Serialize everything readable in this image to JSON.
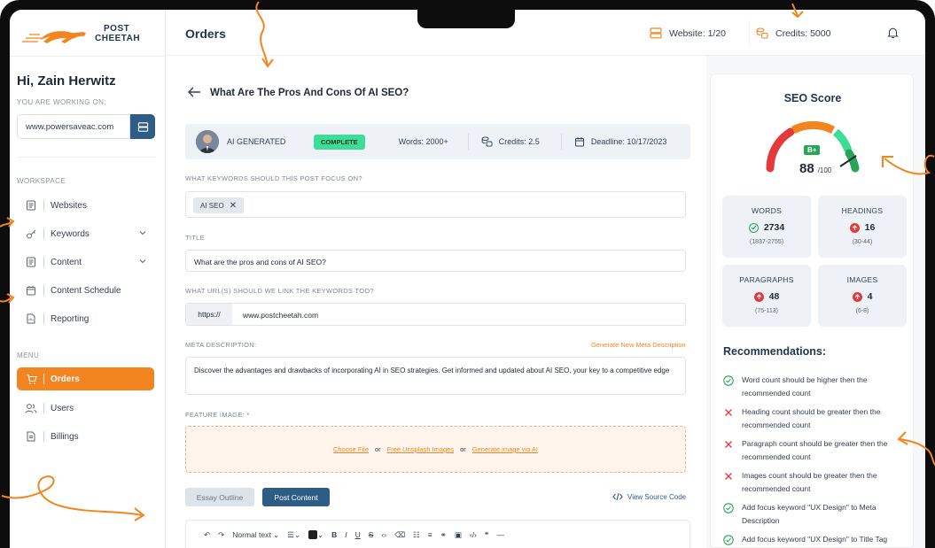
{
  "app": {
    "logo_line1": "POST",
    "logo_line2": "CHEETAH"
  },
  "header": {
    "title": "Orders",
    "website": "Website: 1/20",
    "credits": "Credits: 5000"
  },
  "sidebar": {
    "greeting": "Hi, Zain Herwitz",
    "working_label": "YOU ARE WORKING ON:",
    "site": "www.powersaveac.com",
    "workspace_label": "WORKSPACE",
    "menu_label": "MENU",
    "workspace_items": [
      {
        "label": "Websites",
        "icon": "document-icon"
      },
      {
        "label": "Keywords",
        "icon": "key-icon"
      },
      {
        "label": "Content",
        "icon": "document-icon"
      },
      {
        "label": "Content Schedule",
        "icon": "calendar-icon"
      },
      {
        "label": "Reporting",
        "icon": "report-icon"
      }
    ],
    "menu_items": [
      {
        "label": "Orders",
        "icon": "cart-icon",
        "active": true
      },
      {
        "label": "Users",
        "icon": "users-icon"
      },
      {
        "label": "Billings",
        "icon": "billing-icon"
      }
    ]
  },
  "post": {
    "title": "What Are The Pros And Cons Of AI SEO?",
    "ai_label": "AI GENERATED",
    "status": "COMPLETE",
    "words": "Words: 2000+",
    "credits": "Credits: 2.5",
    "deadline": "Deadline: 10/17/2023",
    "keywords_label": "WHAT KEYWORDS SHOULD THIS POST FOCUS ON?",
    "keyword_chip": "AI SEO",
    "title_label": "TITLE",
    "title_value": "What are the pros and cons of AI SEO?",
    "url_label": "WHAT URL(S) SHOULD WE LINK THE KEYWORDS TOO?",
    "url_prefix": "https://",
    "url_value": "www.postcheetah.com",
    "meta_label": "META DESCRIPTION:",
    "meta_generate": "Generate New Meta Description",
    "meta_value": "Discover the advantages and drawbacks of incorporating AI in SEO strategies. Get informed and updated about AI SEO, your key to a competitive edge",
    "feature_label": "FEATURE IMAGE: *",
    "choose_file": "Choose File",
    "or1": "or",
    "unsplash": "Free Unsplash Images",
    "or2": "or",
    "gen_ai": "Generate image via AI",
    "essay_outline": "Essay Outline",
    "post_content": "Post Content",
    "view_source": "View Source Code",
    "toolbar_style": "Normal text"
  },
  "seo": {
    "title": "SEO Score",
    "grade": "B+",
    "score": "88",
    "score_max": "/100",
    "score_value": 88,
    "stats": [
      {
        "label": "WORDS",
        "value": "2734",
        "range": "(1837-2755)",
        "status": "ok"
      },
      {
        "label": "HEADINGS",
        "value": "16",
        "range": "(30-44)",
        "status": "up"
      },
      {
        "label": "PARAGRAPHS",
        "value": "48",
        "range": "(75-113)",
        "status": "up"
      },
      {
        "label": "IMAGES",
        "value": "4",
        "range": "(6-8)",
        "status": "up"
      }
    ],
    "rec_title": "Recommendations:",
    "recommendations": [
      {
        "text": "Word count should be higher then the recommended count",
        "status": "ok"
      },
      {
        "text": "Heading count should be greater then the recommended count",
        "status": "fail"
      },
      {
        "text": "Paragraph count should be greater then the recommended count",
        "status": "fail"
      },
      {
        "text": "Images count should be greater then the recommended count",
        "status": "fail"
      },
      {
        "text": "Add focus keyword \"UX Design\" to Meta Description",
        "status": "ok"
      },
      {
        "text": "Add focus keyword \"UX Design\" to Title Tag",
        "status": "ok"
      }
    ]
  },
  "colors": {
    "accent": "#f2851f",
    "primary": "#2d5d86",
    "success": "#27a657",
    "danger": "#e5383b"
  }
}
